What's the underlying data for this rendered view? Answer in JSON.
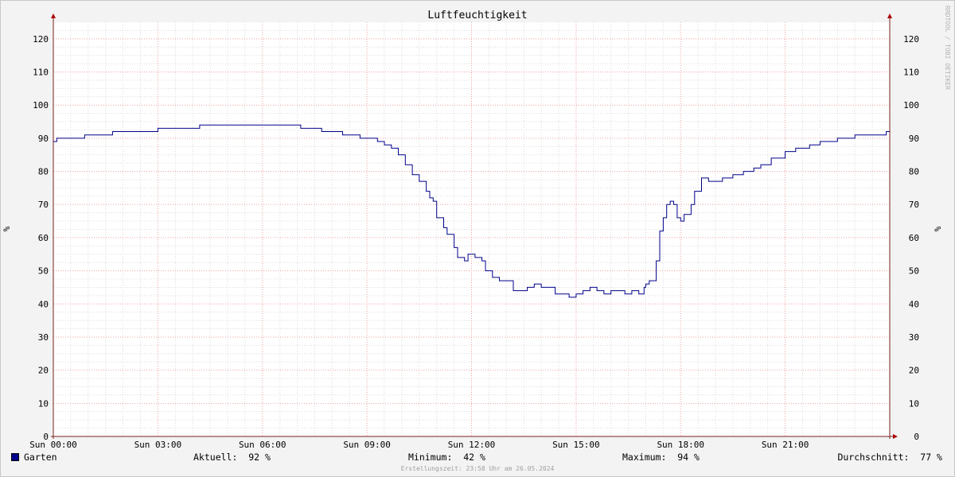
{
  "chart_data": {
    "type": "line",
    "title": "Luftfeuchtigkeit",
    "ylabel": "%",
    "ylim": [
      0,
      125
    ],
    "y_ticks": [
      0,
      10,
      20,
      30,
      40,
      50,
      60,
      70,
      80,
      90,
      100,
      110,
      120
    ],
    "xlim": [
      0,
      24
    ],
    "x_ticks": [
      {
        "x": 0,
        "label": "Sun 00:00"
      },
      {
        "x": 3,
        "label": "Sun 03:00"
      },
      {
        "x": 6,
        "label": "Sun 06:00"
      },
      {
        "x": 9,
        "label": "Sun 09:00"
      },
      {
        "x": 12,
        "label": "Sun 12:00"
      },
      {
        "x": 15,
        "label": "Sun 15:00"
      },
      {
        "x": 18,
        "label": "Sun 18:00"
      },
      {
        "x": 21,
        "label": "Sun 21:00"
      }
    ],
    "grid": true,
    "series": [
      {
        "name": "Garten",
        "color": "#00008b",
        "x": [
          0,
          0.1,
          0.8,
          0.9,
          1.6,
          1.7,
          2.4,
          2.5,
          2.9,
          3.0,
          3.3,
          3.5,
          4.0,
          4.2,
          4.8,
          5.0,
          6.9,
          7.1,
          7.4,
          7.7,
          8.1,
          8.3,
          8.6,
          8.8,
          9.1,
          9.3,
          9.5,
          9.7,
          9.9,
          10.1,
          10.3,
          10.5,
          10.7,
          10.8,
          10.9,
          11.0,
          11.2,
          11.3,
          11.5,
          11.6,
          11.8,
          11.9,
          12.0,
          12.1,
          12.3,
          12.4,
          12.6,
          12.8,
          13.0,
          13.2,
          13.4,
          13.6,
          13.8,
          14.0,
          14.2,
          14.4,
          14.6,
          14.8,
          15.0,
          15.2,
          15.4,
          15.6,
          15.8,
          16.0,
          16.2,
          16.4,
          16.6,
          16.8,
          16.95,
          17.0,
          17.1,
          17.2,
          17.3,
          17.4,
          17.5,
          17.6,
          17.7,
          17.8,
          17.9,
          18.0,
          18.1,
          18.2,
          18.3,
          18.4,
          18.6,
          18.8,
          19.0,
          19.2,
          19.5,
          19.8,
          20.1,
          20.3,
          20.6,
          21.0,
          21.3,
          21.7,
          22.0,
          22.2,
          22.5,
          22.8,
          23.0,
          23.2,
          23.5,
          23.9,
          24.0
        ],
        "values": [
          89,
          90,
          90,
          91,
          91,
          92,
          92,
          92,
          92,
          93,
          93,
          93,
          93,
          94,
          94,
          94,
          94,
          93,
          93,
          92,
          92,
          91,
          91,
          90,
          90,
          89,
          88,
          87,
          85,
          82,
          79,
          77,
          74,
          72,
          71,
          66,
          63,
          61,
          57,
          54,
          53,
          55,
          55,
          54,
          53,
          50,
          48,
          47,
          47,
          44,
          44,
          45,
          46,
          45,
          45,
          43,
          43,
          42,
          43,
          44,
          45,
          44,
          43,
          44,
          44,
          43,
          44,
          43,
          45,
          46,
          47,
          47,
          53,
          62,
          66,
          70,
          71,
          70,
          66,
          65,
          67,
          67,
          70,
          74,
          78,
          77,
          77,
          78,
          79,
          80,
          81,
          82,
          84,
          86,
          87,
          88,
          89,
          89,
          90,
          90,
          91,
          91,
          91,
          92,
          92
        ]
      }
    ]
  },
  "legend": {
    "series_name": "Garten",
    "current": "Aktuell:  92 %",
    "minimum": "Minimum:  42 %",
    "maximum": "Maximum:  94 %",
    "average": "Durchschnitt:  77 %"
  },
  "footer": "Erstellungszeit: 23:58 Uhr am 26.05.2024",
  "vendor": "RRDTOOL / TOBI OETIKER"
}
